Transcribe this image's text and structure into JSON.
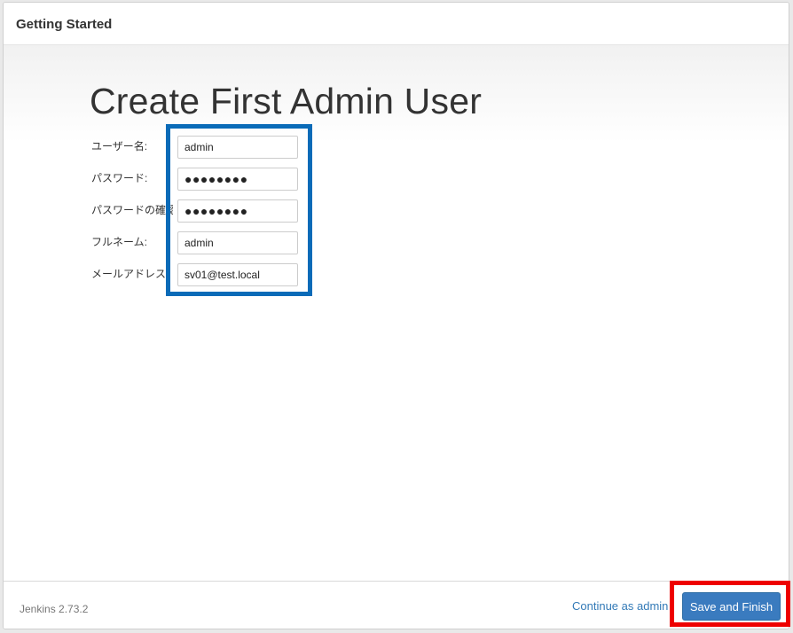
{
  "dialog": {
    "title": "Getting Started"
  },
  "page": {
    "heading": "Create First Admin User"
  },
  "form": {
    "fields": [
      {
        "label": "ユーザー名:",
        "value": "admin"
      },
      {
        "label": "パスワード:",
        "value": "●●●●●●●●"
      },
      {
        "label": "パスワードの確認:",
        "value": "●●●●●●●●"
      },
      {
        "label": "フルネーム:",
        "value": "admin"
      },
      {
        "label": "メールアドレス:",
        "value": "sv01@test.local"
      }
    ]
  },
  "footer": {
    "version": "Jenkins 2.73.2",
    "continue_label": "Continue as admin",
    "save_label": "Save and Finish"
  },
  "colors": {
    "primary_button": "#3a7bbf",
    "link": "#337ab7",
    "field_highlight": "#0a6bb8",
    "button_highlight": "#ee0000"
  }
}
